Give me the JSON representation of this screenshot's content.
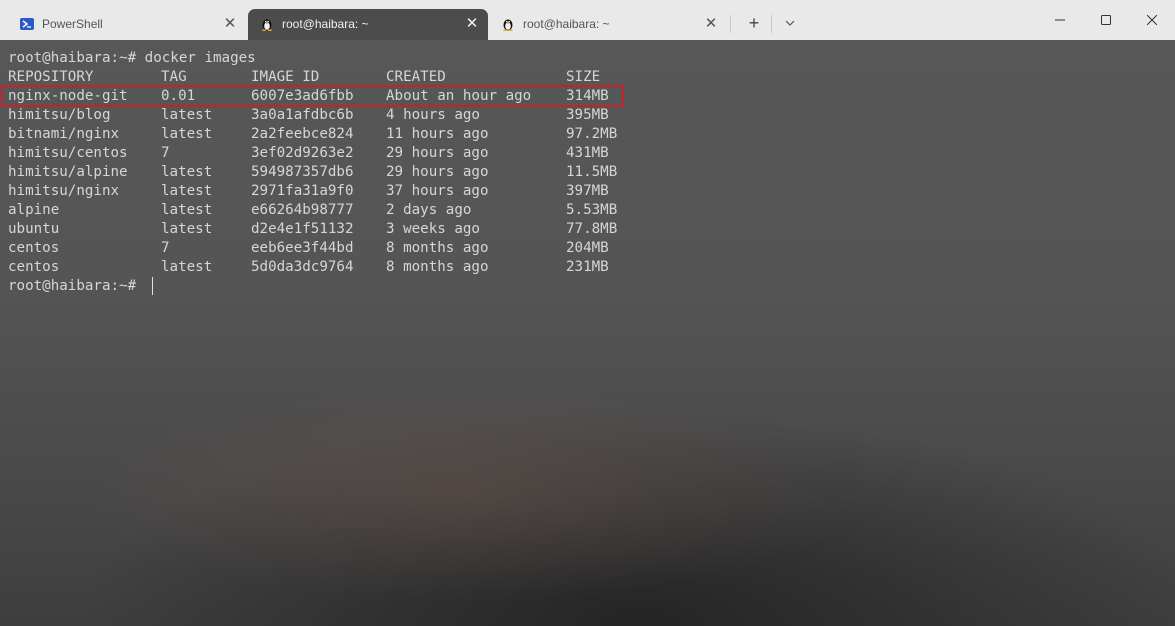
{
  "tabs": [
    {
      "label": "PowerShell",
      "icon": "powershell-icon",
      "active": false
    },
    {
      "label": "root@haibara: ~",
      "icon": "linux-tux-icon",
      "active": true
    },
    {
      "label": "root@haibara: ~",
      "icon": "linux-tux-icon",
      "active": false
    }
  ],
  "toolbar": {
    "new_tab": "+",
    "dropdown": "chevron-down-icon"
  },
  "terminal": {
    "command_line": "root@haibara:~# docker images",
    "headers": {
      "repository": "REPOSITORY",
      "tag": "TAG",
      "image_id": "IMAGE ID",
      "created": "CREATED",
      "size": "SIZE"
    },
    "rows": [
      {
        "repository": "nginx-node-git",
        "tag": "0.01",
        "image_id": "6007e3ad6fbb",
        "created": "About an hour ago",
        "size": "314MB"
      },
      {
        "repository": "himitsu/blog",
        "tag": "latest",
        "image_id": "3a0a1afdbc6b",
        "created": "4 hours ago",
        "size": "395MB"
      },
      {
        "repository": "bitnami/nginx",
        "tag": "latest",
        "image_id": "2a2feebce824",
        "created": "11 hours ago",
        "size": "97.2MB"
      },
      {
        "repository": "himitsu/centos",
        "tag": "7",
        "image_id": "3ef02d9263e2",
        "created": "29 hours ago",
        "size": "431MB"
      },
      {
        "repository": "himitsu/alpine",
        "tag": "latest",
        "image_id": "594987357db6",
        "created": "29 hours ago",
        "size": "11.5MB"
      },
      {
        "repository": "himitsu/nginx",
        "tag": "latest",
        "image_id": "2971fa31a9f0",
        "created": "37 hours ago",
        "size": "397MB"
      },
      {
        "repository": "alpine",
        "tag": "latest",
        "image_id": "e66264b98777",
        "created": "2 days ago",
        "size": "5.53MB"
      },
      {
        "repository": "ubuntu",
        "tag": "latest",
        "image_id": "d2e4e1f51132",
        "created": "3 weeks ago",
        "size": "77.8MB"
      },
      {
        "repository": "centos",
        "tag": "7",
        "image_id": "eeb6ee3f44bd",
        "created": "8 months ago",
        "size": "204MB"
      },
      {
        "repository": "centos",
        "tag": "latest",
        "image_id": "5d0da3dc9764",
        "created": "8 months ago",
        "size": "231MB"
      }
    ],
    "prompt": "root@haibara:~#",
    "highlighted_row_index": 0,
    "highlight_color": "#c4232b"
  },
  "colors": {
    "tabbar_bg": "#e9e9e9",
    "active_tab_bg": "#4c4c4c",
    "terminal_text": "#d6d6d6"
  }
}
